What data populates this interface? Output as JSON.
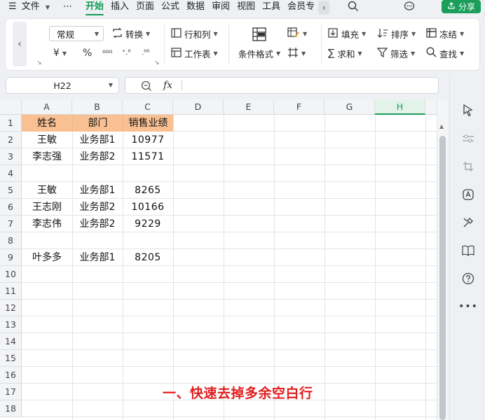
{
  "menubar": {
    "hamburger": "☰",
    "file": "文件",
    "more": "⋯",
    "tabs": [
      "开始",
      "插入",
      "页面",
      "公式",
      "数据",
      "审阅",
      "视图",
      "工具",
      "会员专"
    ],
    "active_tab": "开始",
    "share": "分享"
  },
  "ribbon": {
    "number_format": "常规",
    "convert": "转换",
    "rows_cols": "行和列",
    "worksheet": "工作表",
    "cond_format": "条件格式",
    "fill": "填充",
    "sort": "排序",
    "freeze": "冻结",
    "sum": "求和",
    "filter": "筛选",
    "find": "查找",
    "currency_symbol": "¥",
    "percent_symbol": "%",
    "thousands_symbol": "⁰⁰⁰"
  },
  "formula_bar": {
    "cell_ref": "H22",
    "fx": "fx",
    "value": ""
  },
  "sheet": {
    "columns": [
      "A",
      "B",
      "C",
      "D",
      "E",
      "F",
      "G",
      "H"
    ],
    "selected_column": "H",
    "rows": [
      "1",
      "2",
      "3",
      "4",
      "5",
      "6",
      "7",
      "8",
      "9",
      "10",
      "11",
      "12",
      "13",
      "14",
      "15",
      "16",
      "17",
      "18"
    ],
    "headers": [
      "姓名",
      "部门",
      "销售业绩"
    ],
    "data": [
      {
        "row": 2,
        "name": "王敏",
        "dept": "业务部1",
        "sales": "10977"
      },
      {
        "row": 3,
        "name": "李志强",
        "dept": "业务部2",
        "sales": "11571"
      },
      {
        "row": 5,
        "name": "王敏",
        "dept": "业务部1",
        "sales": "8265"
      },
      {
        "row": 6,
        "name": "王志刚",
        "dept": "业务部2",
        "sales": "10166"
      },
      {
        "row": 7,
        "name": "李志伟",
        "dept": "业务部2",
        "sales": "9229"
      },
      {
        "row": 9,
        "name": "叶多多",
        "dept": "业务部1",
        "sales": "8205"
      }
    ],
    "header_fill": "#f9c193"
  },
  "overlay": {
    "caption": "一、快速去掉多余空白行",
    "color": "#e31c1c"
  },
  "colors": {
    "accent": "#1a9e5a"
  }
}
